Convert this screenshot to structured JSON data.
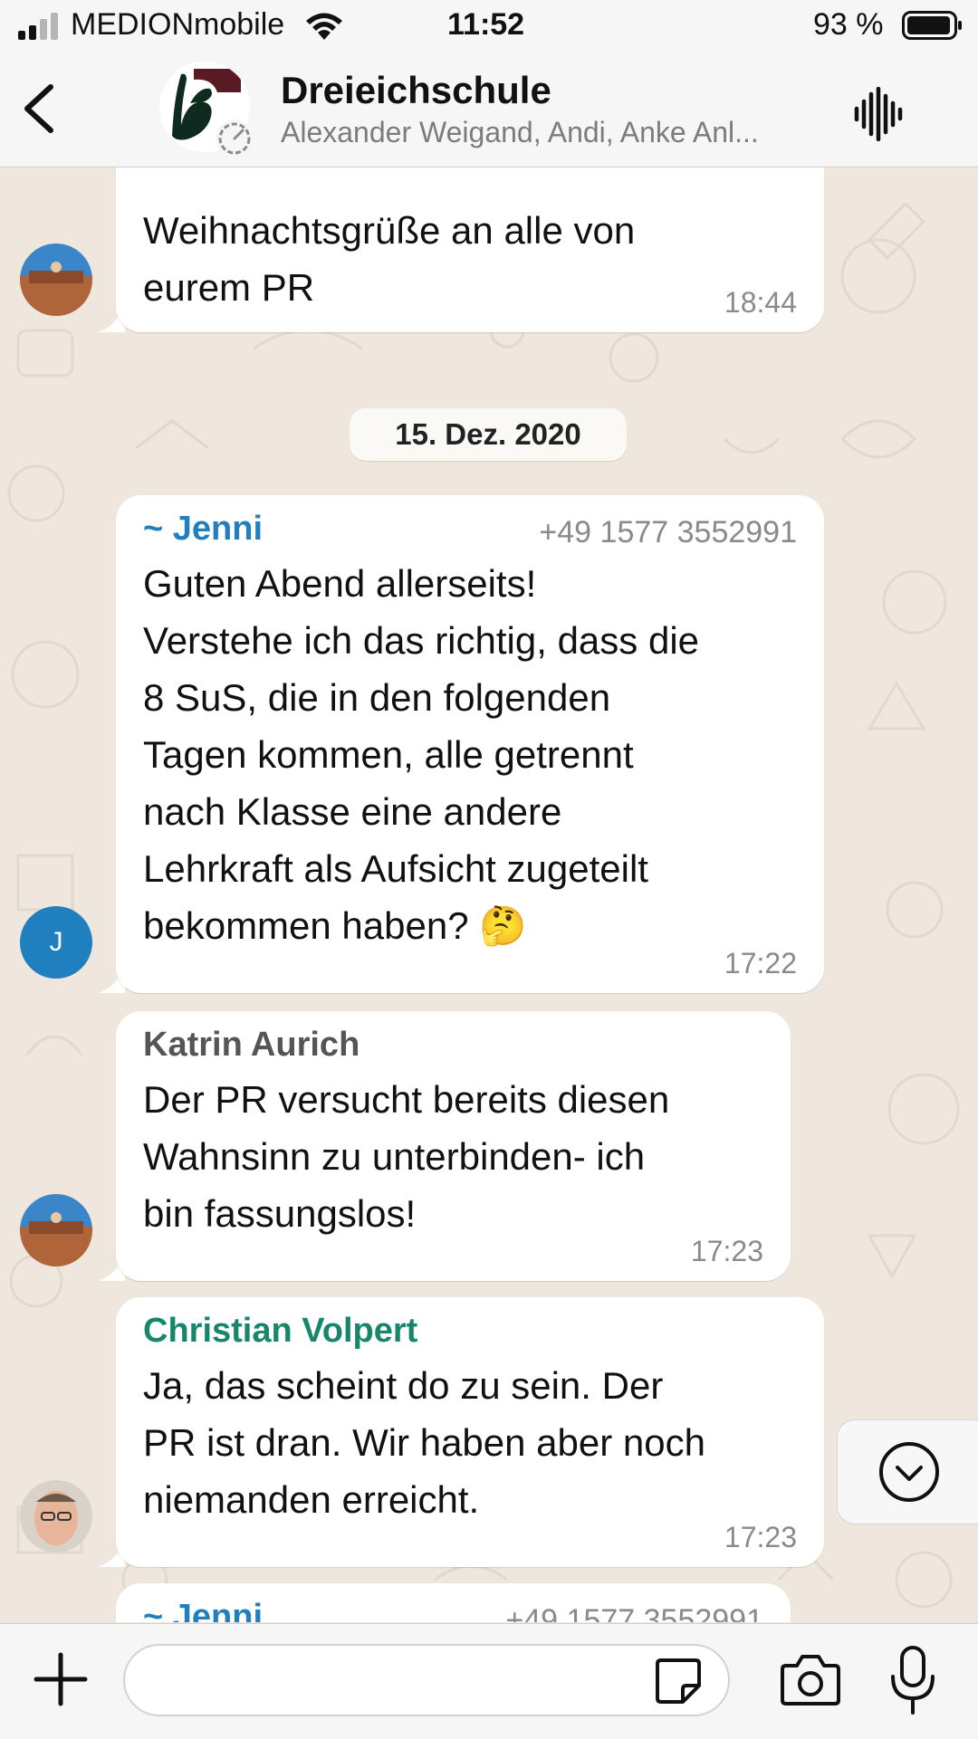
{
  "status_bar": {
    "carrier": "MEDIONmobile",
    "time": "11:52",
    "battery": "93 %"
  },
  "header": {
    "title": "Dreieichschule",
    "members": "Alexander Weigand, Andi, Anke Anl..."
  },
  "date_separator": "15. Dez. 2020",
  "messages": [
    {
      "sender": "",
      "text": "Weihnachtsgrüße an alle von\neurem PR",
      "time": "18:44"
    },
    {
      "sender": "~ Jenni",
      "phone": "+49 1577 3552991",
      "avatar_letter": "J",
      "text": "Guten Abend allerseits!\nVerstehe ich das richtig, dass die\n8 SuS, die in den folgenden\nTagen kommen, alle getrennt\nnach Klasse eine andere\nLehrkraft als Aufsicht zugeteilt\nbekommen haben? 🤔",
      "time": "17:22"
    },
    {
      "sender": "Katrin Aurich",
      "text": "Der PR versucht bereits diesen\nWahnsinn zu unterbinden- ich\nbin fassungslos!",
      "time": "17:23"
    },
    {
      "sender": "Christian Volpert",
      "text": "Ja, das scheint do zu sein. Der\nPR ist dran. Wir haben aber noch\nniemanden erreicht.",
      "time": "17:23"
    },
    {
      "sender": "~ Jenni",
      "phone": "+49 1577 3552991"
    }
  ],
  "colors": {
    "wallpaper": "#efe7dd",
    "jenni_name": "#1f7fbf",
    "katrin_name": "#555555",
    "christian_name": "#17866b"
  },
  "icons": {
    "signal": "signal-icon",
    "wifi": "wifi-icon",
    "battery": "battery-icon",
    "back": "chevron-left-icon",
    "voice": "waveform-icon",
    "scroll_down": "chevron-down-circle-icon",
    "plus": "plus-icon",
    "sticker": "sticker-icon",
    "camera": "camera-icon",
    "mic": "microphone-icon"
  }
}
